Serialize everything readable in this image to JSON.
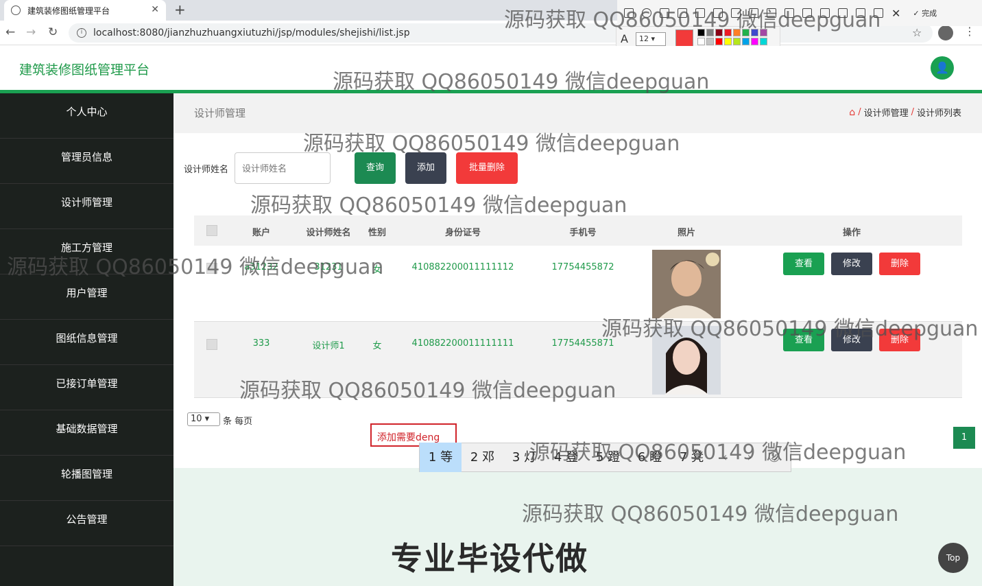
{
  "browser": {
    "tab_title": "建筑装修图纸管理平台",
    "url": "localhost:8080/jianzhuzhuangxiutuzhi/jsp/modules/shejishi/list.jsp",
    "close_glyph": "✕",
    "new_tab_glyph": "+",
    "back_glyph": "←",
    "forward_glyph": "→",
    "reload_glyph": "↻",
    "star_glyph": "☆",
    "menu_glyph": "⋮",
    "info_glyph": "i"
  },
  "snaptool": {
    "done_label": "✓ 完成",
    "font_size": "12 ▾",
    "font_glyph": "A",
    "swatch_colors": [
      "#000000",
      "#7f7f7f",
      "#880015",
      "#ed1c24",
      "#ff7f27",
      "#22b14c",
      "#3f48cc",
      "#a349a4",
      "#ffffff",
      "#c3c3c3",
      "#ff0000",
      "#ffff00",
      "#b5e61d",
      "#00a2e8",
      "#ff00ff",
      "#00d7d7"
    ]
  },
  "app": {
    "title": "建筑装修图纸管理平台",
    "avatar_glyph": "👤"
  },
  "sidebar": {
    "items": [
      {
        "label": "个人中心"
      },
      {
        "label": "管理员信息"
      },
      {
        "label": "设计师管理"
      },
      {
        "label": "施工方管理"
      },
      {
        "label": "用户管理"
      },
      {
        "label": "图纸信息管理"
      },
      {
        "label": "已接订单管理"
      },
      {
        "label": "基础数据管理"
      },
      {
        "label": "轮播图管理"
      },
      {
        "label": "公告管理"
      }
    ]
  },
  "page": {
    "title": "设计师管理",
    "breadcrumb": {
      "home_glyph": "⌂",
      "sep": "/",
      "level1": "设计师管理",
      "level2": "设计师列表"
    },
    "search": {
      "label": "设计师姓名",
      "placeholder": "设计师姓名"
    },
    "buttons": {
      "query": "查询",
      "add": "添加",
      "batch_delete": "批量删除"
    }
  },
  "table": {
    "headers": {
      "account": "账户",
      "name": "设计师姓名",
      "gender": "性别",
      "id_card": "身份证号",
      "phone": "手机号",
      "photo": "照片",
      "ops": "操作"
    },
    "rows": [
      {
        "account": "a31232",
        "name": "31231",
        "gender": "女",
        "id_card": "410882200011111112",
        "phone": "17754455872"
      },
      {
        "account": "333",
        "name": "设计师1",
        "gender": "女",
        "id_card": "410882200011111111",
        "phone": "17754455871"
      }
    ],
    "actions": {
      "view": "查看",
      "edit": "修改",
      "delete": "删除"
    }
  },
  "pagination": {
    "page_size": "10",
    "page_size_suffix": "条 每页",
    "current_page": "1"
  },
  "ime": {
    "composition": "添加需要deng",
    "candidates": [
      "1 等",
      "2 邓",
      "3 灯",
      "4 登",
      "5 蹬",
      "6 瞪",
      "7 凳"
    ],
    "prev": "‹",
    "next": "›",
    "emoji": "☺"
  },
  "back_to_top": "Top",
  "watermark": "源码获取 QQ86050149 微信deepguan",
  "promo_text": "专业毕设代做"
}
